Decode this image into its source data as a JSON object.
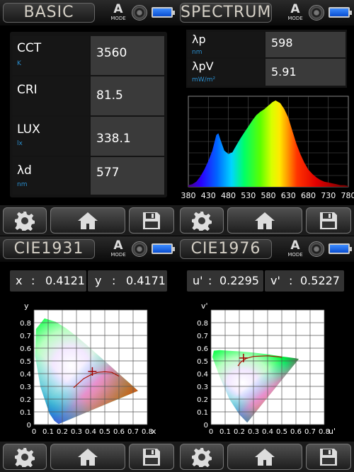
{
  "basic": {
    "title": "BASIC",
    "mode_letter": "A",
    "mode_label": "MODE",
    "rows": [
      {
        "label": "CCT",
        "unit": "K",
        "value": "3560"
      },
      {
        "label": "CRI",
        "unit": "",
        "value": "81.5"
      },
      {
        "label": "LUX",
        "unit": "lx",
        "value": "338.1"
      },
      {
        "label": "λd",
        "unit": "nm",
        "value": "577"
      }
    ]
  },
  "spectrum": {
    "title": "SPECTRUM",
    "mode_letter": "A",
    "mode_label": "MODE",
    "rows": [
      {
        "label": "λp",
        "unit": "nm",
        "value": "598"
      },
      {
        "label": "λpV",
        "unit": "mW/m²",
        "value": "5.91"
      }
    ],
    "chart_data": {
      "type": "area",
      "x": [
        380,
        390,
        400,
        410,
        420,
        430,
        440,
        450,
        455,
        460,
        470,
        480,
        490,
        500,
        510,
        520,
        530,
        540,
        550,
        560,
        570,
        580,
        590,
        598,
        610,
        620,
        630,
        640,
        650,
        660,
        670,
        680,
        690,
        700,
        710,
        720,
        730,
        740,
        750,
        760,
        770,
        780
      ],
      "y": [
        0.02,
        0.03,
        0.06,
        0.12,
        0.2,
        0.3,
        0.42,
        0.6,
        0.62,
        0.55,
        0.42,
        0.38,
        0.4,
        0.48,
        0.56,
        0.63,
        0.7,
        0.77,
        0.83,
        0.87,
        0.9,
        0.94,
        0.98,
        1.0,
        0.97,
        0.9,
        0.8,
        0.65,
        0.5,
        0.38,
        0.28,
        0.2,
        0.15,
        0.11,
        0.08,
        0.06,
        0.05,
        0.04,
        0.03,
        0.02,
        0.02,
        0.01
      ],
      "xticks": [
        "380",
        "430",
        "480",
        "530",
        "580",
        "630",
        "680",
        "730",
        "780"
      ],
      "xlim": [
        380,
        780
      ]
    }
  },
  "cie1931": {
    "title": "CIE1931",
    "mode_letter": "A",
    "mode_label": "MODE",
    "x_label": "x",
    "x_value": "0.4121",
    "y_label": "y",
    "y_value": "0.4171",
    "chart_data": {
      "type": "scatter",
      "xlabel": "x",
      "ylabel": "y",
      "xticks": [
        "0",
        "0.1",
        "0.2",
        "0.3",
        "0.4",
        "0.5",
        "0.6",
        "0.7",
        "0.8"
      ],
      "yticks": [
        "0",
        "0.1",
        "0.2",
        "0.3",
        "0.4",
        "0.5",
        "0.6",
        "0.7",
        "0.8"
      ],
      "point": [
        0.4121,
        0.4171
      ],
      "xlim": [
        0,
        0.8
      ],
      "ylim": [
        0,
        0.9
      ],
      "locus": [
        [
          0.1741,
          0.005
        ],
        [
          0.144,
          0.03
        ],
        [
          0.1096,
          0.0868
        ],
        [
          0.0454,
          0.295
        ],
        [
          0.0082,
          0.5384
        ],
        [
          0.0139,
          0.7502
        ],
        [
          0.0743,
          0.8338
        ],
        [
          0.1547,
          0.8059
        ],
        [
          0.2296,
          0.7543
        ],
        [
          0.3016,
          0.6923
        ],
        [
          0.3731,
          0.6245
        ],
        [
          0.4441,
          0.5547
        ],
        [
          0.5125,
          0.4866
        ],
        [
          0.5752,
          0.4242
        ],
        [
          0.627,
          0.3725
        ],
        [
          0.6658,
          0.334
        ],
        [
          0.6915,
          0.3083
        ],
        [
          0.7347,
          0.2653
        ]
      ],
      "planckian": [
        [
          0.6,
          0.38
        ],
        [
          0.55,
          0.41
        ],
        [
          0.5,
          0.415
        ],
        [
          0.45,
          0.41
        ],
        [
          0.4,
          0.39
        ],
        [
          0.35,
          0.36
        ],
        [
          0.31,
          0.32
        ],
        [
          0.28,
          0.29
        ]
      ]
    }
  },
  "cie1976": {
    "title": "CIE1976",
    "mode_letter": "A",
    "mode_label": "MODE",
    "u_label": "u'",
    "u_value": "0.2295",
    "v_label": "v'",
    "v_value": "0.5227",
    "chart_data": {
      "type": "scatter",
      "xlabel": "u'",
      "ylabel": "v'",
      "xticks": [
        "0",
        "0.1",
        "0.2",
        "0.3",
        "0.4",
        "0.5",
        "0.6",
        "0.7",
        "0.8"
      ],
      "yticks": [
        "0",
        "0.1",
        "0.2",
        "0.3",
        "0.4",
        "0.5",
        "0.6",
        "0.7",
        "0.8"
      ],
      "point": [
        0.2295,
        0.5227
      ],
      "xlim": [
        0,
        0.8
      ],
      "ylim": [
        0,
        0.9
      ],
      "locus": [
        [
          0.256,
          0.016
        ],
        [
          0.2,
          0.08
        ],
        [
          0.13,
          0.2
        ],
        [
          0.06,
          0.38
        ],
        [
          0.01,
          0.53
        ],
        [
          0.02,
          0.58
        ],
        [
          0.06,
          0.585
        ],
        [
          0.12,
          0.58
        ],
        [
          0.2,
          0.575
        ],
        [
          0.3,
          0.565
        ],
        [
          0.4,
          0.552
        ],
        [
          0.5,
          0.535
        ],
        [
          0.6,
          0.52
        ],
        [
          0.62,
          0.515
        ]
      ],
      "planckian": [
        [
          0.5,
          0.53
        ],
        [
          0.4,
          0.54
        ],
        [
          0.3,
          0.535
        ],
        [
          0.25,
          0.52
        ],
        [
          0.21,
          0.49
        ],
        [
          0.19,
          0.46
        ]
      ]
    }
  },
  "buttons": {
    "settings": "settings",
    "home": "home",
    "save": "save"
  }
}
